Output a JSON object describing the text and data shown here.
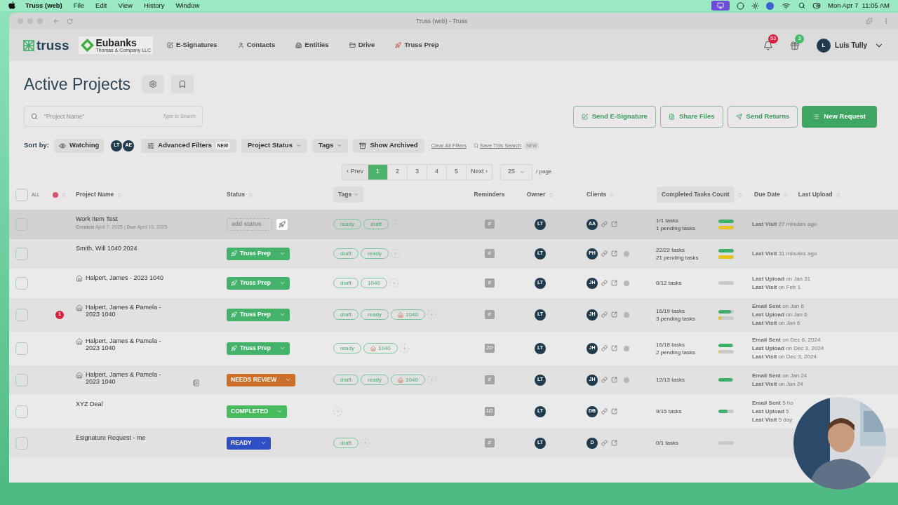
{
  "menubar": {
    "app": "Truss (web)",
    "menus": [
      "File",
      "Edit",
      "View",
      "History",
      "Window"
    ],
    "clock": "Mon Apr 7  11:05 AM"
  },
  "browser": {
    "title": "Truss (web) - Truss"
  },
  "nav": {
    "brand": "truss",
    "firm": {
      "name": "Eubanks",
      "subtitle": "Thomas & Company LLC"
    },
    "items": [
      {
        "label": "E-Signatures"
      },
      {
        "label": "Contacts"
      },
      {
        "label": "Entities"
      },
      {
        "label": "Drive"
      },
      {
        "label": "Truss Prep"
      }
    ],
    "notifications": "53",
    "gifts": "3",
    "user": {
      "initial": "L",
      "name": "Luis Tully"
    }
  },
  "page": {
    "title": "Active Projects",
    "search": {
      "placeholder": "\"Project Name\"",
      "hint": "Type to Search"
    },
    "actions": [
      {
        "label": "Send E-Signature",
        "primary": false
      },
      {
        "label": "Share Files",
        "primary": false
      },
      {
        "label": "Send Returns",
        "primary": false
      },
      {
        "label": "New Request",
        "primary": true
      }
    ]
  },
  "filters": {
    "sort_label": "Sort by:",
    "watching": "Watching",
    "people": [
      "LT",
      "AE"
    ],
    "items": [
      {
        "label": "Advanced Filters",
        "badge": "NEW",
        "kind": "filters"
      },
      {
        "label": "Project Status",
        "kind": "dropdown"
      },
      {
        "label": "Tags",
        "kind": "dropdown"
      },
      {
        "label": "Show Archived",
        "kind": "archive"
      }
    ],
    "links": [
      {
        "label": "Clear All Filters"
      },
      {
        "label": "Save This Search",
        "badge": "NEW"
      }
    ]
  },
  "pagination": {
    "prev": "‹ Prev",
    "next": "Next ›",
    "page_size": "25",
    "per_page": "/ page",
    "pages": [
      {
        "label": "1",
        "selected": true
      },
      {
        "label": "2",
        "selected": false
      },
      {
        "label": "3",
        "selected": false
      },
      {
        "label": "4",
        "selected": false
      },
      {
        "label": "5",
        "selected": false
      }
    ]
  },
  "table": {
    "select_all": {
      "label": "ALL",
      "checked": false
    },
    "columns": [
      {
        "label": "Project Name",
        "kind": "sort",
        "highlighted": false
      },
      {
        "label": "Status",
        "kind": "sort",
        "highlighted": false
      },
      {
        "label": "Tags",
        "kind": "menu",
        "highlighted": true
      },
      {
        "label": "Reminders",
        "kind": "plain",
        "highlighted": false
      },
      {
        "label": "Owner",
        "kind": "sort",
        "highlighted": false
      },
      {
        "label": "Clients",
        "kind": "sort",
        "highlighted": false
      },
      {
        "label": "Completed Tasks Count",
        "kind": "sort",
        "highlighted": true
      },
      {
        "label": "Due Date",
        "kind": "sort",
        "highlighted": false
      },
      {
        "label": "Last Upload",
        "kind": "sort",
        "highlighted": false
      }
    ],
    "rows": [
      {
        "name": "Work Item Test",
        "details": "**Created** April 7, 2025 | **Due** April 10, 2025",
        "home": false,
        "checked": false,
        "highlighted": true,
        "status": {
          "kind": "add",
          "label": "add status"
        },
        "prep_button": true,
        "tags": [
          {
            "label": "ready"
          },
          {
            "label": "draft"
          }
        ],
        "reminder": "d",
        "owner": "LT",
        "client": {
          "initials": "AA",
          "chat": false
        },
        "tasks": [
          "1/1 tasks",
          "1 pending tasks"
        ],
        "bars": [
          {
            "kind": "done",
            "level": 1
          },
          {
            "kind": "pending",
            "level": 1
          }
        ],
        "activity": [
          {
            "label": "Last Visit",
            "text": "27 minutes ago"
          }
        ]
      },
      {
        "name": "Smith, Will 1040 2024",
        "home": false,
        "checked": false,
        "highlighted": false,
        "status": {
          "kind": "prep",
          "label": "Truss Prep"
        },
        "tags": [
          {
            "label": "draft"
          },
          {
            "label": "ready"
          }
        ],
        "reminder": "d",
        "owner": "LT",
        "client": {
          "initials": "PH",
          "chat": true
        },
        "tasks": [
          "22/22 tasks",
          "21 pending tasks"
        ],
        "bars": [
          {
            "kind": "done",
            "level": 1
          },
          {
            "kind": "pending",
            "level": 1
          }
        ],
        "activity": [
          {
            "label": "Last Visit",
            "text": "31 minutes ago"
          }
        ]
      },
      {
        "name": "Halpert, James - 2023 1040",
        "home": true,
        "checked": false,
        "highlighted": false,
        "status": {
          "kind": "prep",
          "label": "Truss Prep"
        },
        "tags": [
          {
            "label": "draft"
          },
          {
            "label": "1040"
          }
        ],
        "reminder": "d",
        "owner": "LT",
        "client": {
          "initials": "JH",
          "chat": true
        },
        "tasks": [
          "0/12 tasks"
        ],
        "bars": [
          {
            "kind": "done",
            "level": 0
          }
        ],
        "activity": [
          {
            "label": "Last Upload",
            "text": "on Jan 31"
          },
          {
            "label": "Last Visit",
            "text": "on Feb 1"
          }
        ]
      },
      {
        "name": "Halpert, James & Pamela - 2023 1040",
        "home": true,
        "alert": "1",
        "checked": false,
        "highlighted": false,
        "status": {
          "kind": "prep",
          "label": "Truss Prep"
        },
        "tags": [
          {
            "label": "draft"
          },
          {
            "label": "ready"
          },
          {
            "label": "1040",
            "home": true
          }
        ],
        "reminder": "d",
        "owner": "LT",
        "client": {
          "initials": "JH",
          "chat": true
        },
        "tasks": [
          "16/19 tasks",
          "3 pending tasks"
        ],
        "bars": [
          {
            "kind": "done",
            "level": 0.84
          },
          {
            "kind": "pending",
            "level": 0.16
          }
        ],
        "activity": [
          {
            "label": "Email Sent",
            "text": "on Jan 6"
          },
          {
            "label": "Last Upload",
            "text": "on Jan 6"
          },
          {
            "label": "Last Visit",
            "text": "on Jan 6"
          }
        ]
      },
      {
        "name": "Halpert, James & Pamela - 2023 1040",
        "home": true,
        "checked": false,
        "highlighted": false,
        "status": {
          "kind": "prep",
          "label": "Truss Prep"
        },
        "tags": [
          {
            "label": "ready"
          },
          {
            "label": "1040",
            "home": true
          }
        ],
        "reminder": "2D",
        "owner": "LT",
        "client": {
          "initials": "JH",
          "chat": true
        },
        "tasks": [
          "16/18 tasks",
          "2 pending tasks"
        ],
        "bars": [
          {
            "kind": "done",
            "level": 0.89
          },
          {
            "kind": "pending",
            "level": 0.11
          }
        ],
        "activity": [
          {
            "label": "Email Sent",
            "text": "on Dec 6, 2024"
          },
          {
            "label": "Last Upload",
            "text": "on Dec 3, 2024"
          },
          {
            "label": "Last Visit",
            "text": "on Dec 3, 2024"
          }
        ]
      },
      {
        "name": "Halpert, James & Pamela - 2023 1040",
        "home": true,
        "note": true,
        "checked": false,
        "highlighted": false,
        "status": {
          "kind": "review",
          "label": "NEEDS REVIEW"
        },
        "tags": [
          {
            "label": "draft"
          },
          {
            "label": "ready"
          },
          {
            "label": "1040",
            "home": true
          }
        ],
        "reminder": "d",
        "owner": "LT",
        "client": {
          "initials": "JH",
          "chat": true
        },
        "tasks": [
          "12/13 tasks"
        ],
        "bars": [
          {
            "kind": "done",
            "level": 0.93
          }
        ],
        "activity": [
          {
            "label": "Email Sent",
            "text": "on Jan 24"
          },
          {
            "label": "Last Visit",
            "text": "on Jan 24"
          }
        ]
      },
      {
        "name": "XYZ Deal",
        "home": false,
        "checked": false,
        "highlighted": false,
        "status": {
          "kind": "completed",
          "label": "COMPLETED"
        },
        "reminder": "1D",
        "owner": "LT",
        "client": {
          "initials": "DB",
          "chat": false
        },
        "tasks": [
          "9/15 tasks"
        ],
        "bars": [
          {
            "kind": "done",
            "level": 0.6
          }
        ],
        "activity": [
          {
            "label": "Email Sent",
            "text": "5 ho"
          },
          {
            "label": "Last Upload",
            "text": "5"
          },
          {
            "label": "Last Visit",
            "text": "5 day"
          }
        ]
      },
      {
        "name": "Esignature Request - me",
        "home": false,
        "checked": false,
        "highlighted": false,
        "status": {
          "kind": "ready",
          "label": "READY"
        },
        "tags": [
          {
            "label": "draft"
          }
        ],
        "reminder": "d",
        "owner": "LT",
        "client": {
          "initials": "D",
          "chat": false
        },
        "tasks": [
          "0/1 tasks"
        ],
        "bars": [
          {
            "kind": "done",
            "level": 0
          }
        ]
      }
    ]
  }
}
